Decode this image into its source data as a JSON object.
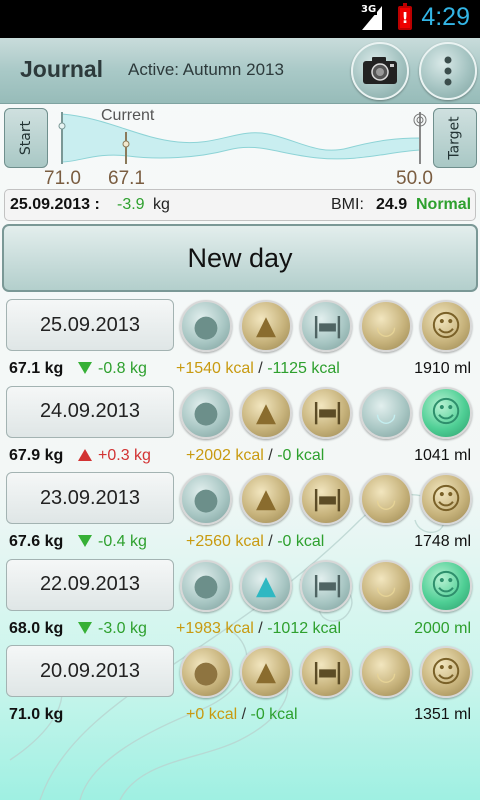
{
  "status": {
    "network": "3G",
    "battery_alert": "!",
    "time": "4:29"
  },
  "header": {
    "title": "Journal",
    "active_label": "Active: Autumn 2013",
    "camera_icon": "camera-icon",
    "overflow_icon": "overflow-menu-icon"
  },
  "progress": {
    "start_label": "Start",
    "target_label": "Target",
    "current_label": "Current",
    "start_value": "71.0",
    "current_value": "67.1",
    "target_value": "50.0"
  },
  "summary": {
    "date": "25.09.2013 :",
    "delta": "-3.9",
    "unit": "kg",
    "bmi_label": "BMI:",
    "bmi_value": "24.9",
    "bmi_status": "Normal"
  },
  "new_day_label": "New day",
  "days": [
    {
      "date": "25.09.2013",
      "weight": "67.1 kg",
      "trend": "down",
      "delta": "-0.8 kg",
      "kcal_in": "+1540 kcal",
      "sep": " / ",
      "kcal_out": "-1125 kcal",
      "water": "1910 ml",
      "icons": [
        "teal",
        "gold",
        "teal",
        "gold",
        "gold"
      ]
    },
    {
      "date": "24.09.2013",
      "weight": "67.9 kg",
      "trend": "up",
      "delta": "+0.3 kg",
      "kcal_in": "+2002 kcal",
      "sep": " / ",
      "kcal_out": "-0 kcal",
      "water": "1041 ml",
      "icons": [
        "teal",
        "gold",
        "gold",
        "teal",
        "teal"
      ]
    },
    {
      "date": "23.09.2013",
      "weight": "67.6 kg",
      "trend": "down",
      "delta": "-0.4 kg",
      "kcal_in": "+2560 kcal",
      "sep": " / ",
      "kcal_out": "-0 kcal",
      "water": "1748 ml",
      "icons": [
        "teal",
        "gold",
        "gold",
        "gold",
        "gold"
      ]
    },
    {
      "date": "22.09.2013",
      "weight": "68.0 kg",
      "trend": "down",
      "delta": "-3.0 kg",
      "kcal_in": "+1983 kcal",
      "sep": " / ",
      "kcal_out": "-1012 kcal",
      "water": "2000 ml",
      "icons": [
        "teal",
        "teal",
        "teal",
        "gold",
        "teal"
      ]
    },
    {
      "date": "20.09.2013",
      "weight": "71.0 kg",
      "trend": "none",
      "delta": "",
      "kcal_in": "+0 kcal",
      "sep": " / ",
      "kcal_out": "-0 kcal",
      "water": "1351 ml",
      "icons": [
        "gold",
        "gold",
        "gold",
        "gold",
        "gold"
      ]
    }
  ],
  "icon_names": [
    "apple-icon",
    "water-drop-icon",
    "dumbbell-icon",
    "food-bowl-icon",
    "smiley-icon"
  ],
  "colors": {
    "accent": "#33b5e5",
    "positive": "#2ea02e",
    "negative": "#d23333",
    "kcal": "#c89a10"
  }
}
